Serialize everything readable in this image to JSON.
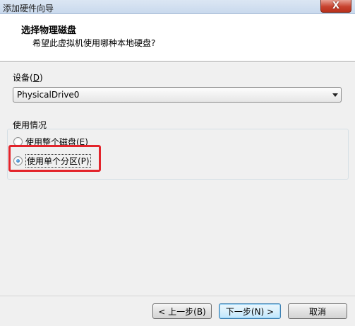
{
  "window": {
    "title": "添加硬件向导",
    "close_symbol": "X"
  },
  "header": {
    "title": "选择物理磁盘",
    "subtitle": "希望此虚拟机使用哪种本地硬盘?"
  },
  "device": {
    "label": "设备(D)",
    "label_main": "设备(",
    "label_key": "D",
    "label_end": ")",
    "selected": "PhysicalDrive0"
  },
  "usage": {
    "group_label": "使用情况",
    "options": [
      {
        "label": "使用整个磁盘(E)",
        "checked": false
      },
      {
        "label": "使用单个分区(P)",
        "checked": true
      }
    ]
  },
  "buttons": {
    "back": "< 上一步(B)",
    "next": "下一步(N) >",
    "cancel": "取消"
  },
  "colors": {
    "highlight": "#e3242b"
  }
}
